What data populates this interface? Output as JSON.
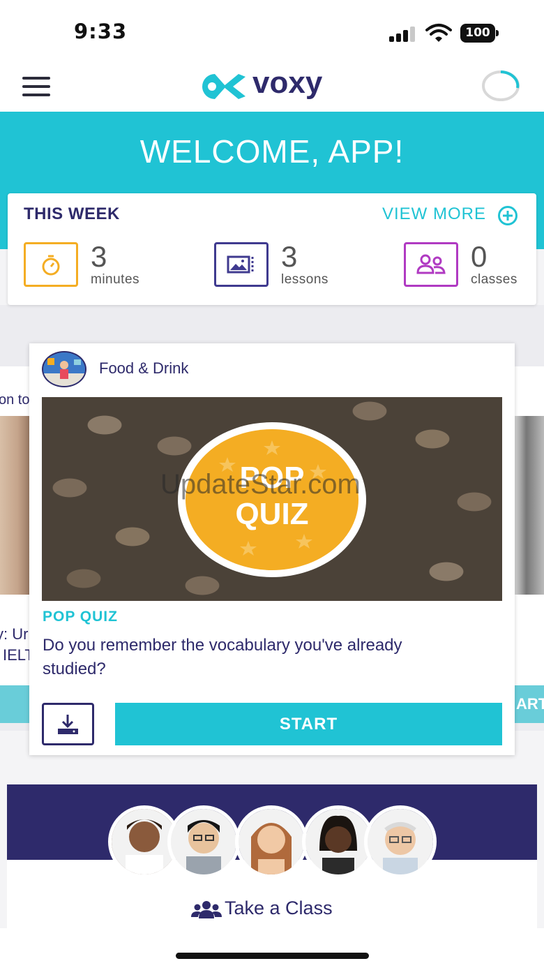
{
  "status_bar": {
    "time": "9:33",
    "battery": "100"
  },
  "nav": {
    "logo_text": "voxy"
  },
  "banner": {
    "welcome": "WELCOME, APP!"
  },
  "this_week": {
    "title": "THIS WEEK",
    "view_more": "VIEW MORE",
    "stats": [
      {
        "value": "3",
        "label": "minutes",
        "icon": "stopwatch-icon",
        "color": "#f4ad23"
      },
      {
        "value": "3",
        "label": "lessons",
        "icon": "photo-gallery-icon",
        "color": "#3f3a8f"
      },
      {
        "value": "0",
        "label": "classes",
        "icon": "people-icon",
        "color": "#b03ac2"
      }
    ]
  },
  "side_cards": {
    "left_top": "on to",
    "left_line1": "y: Ur",
    "left_line2": "IELT",
    "right_button": "ART"
  },
  "lesson": {
    "topic": "Food & Drink",
    "watermark": "UpdateStar.com",
    "badge_line1": "POP",
    "badge_line2": "QUIZ",
    "type": "POP QUIZ",
    "description": "Do you remember the vocabulary you've already studied?",
    "start_label": "START"
  },
  "take_class": {
    "label": "Take a Class"
  },
  "colors": {
    "brand_cyan": "#20c3d4",
    "brand_navy": "#2e2a6b",
    "accent_orange": "#f4ad23",
    "accent_purple": "#b03ac2"
  }
}
